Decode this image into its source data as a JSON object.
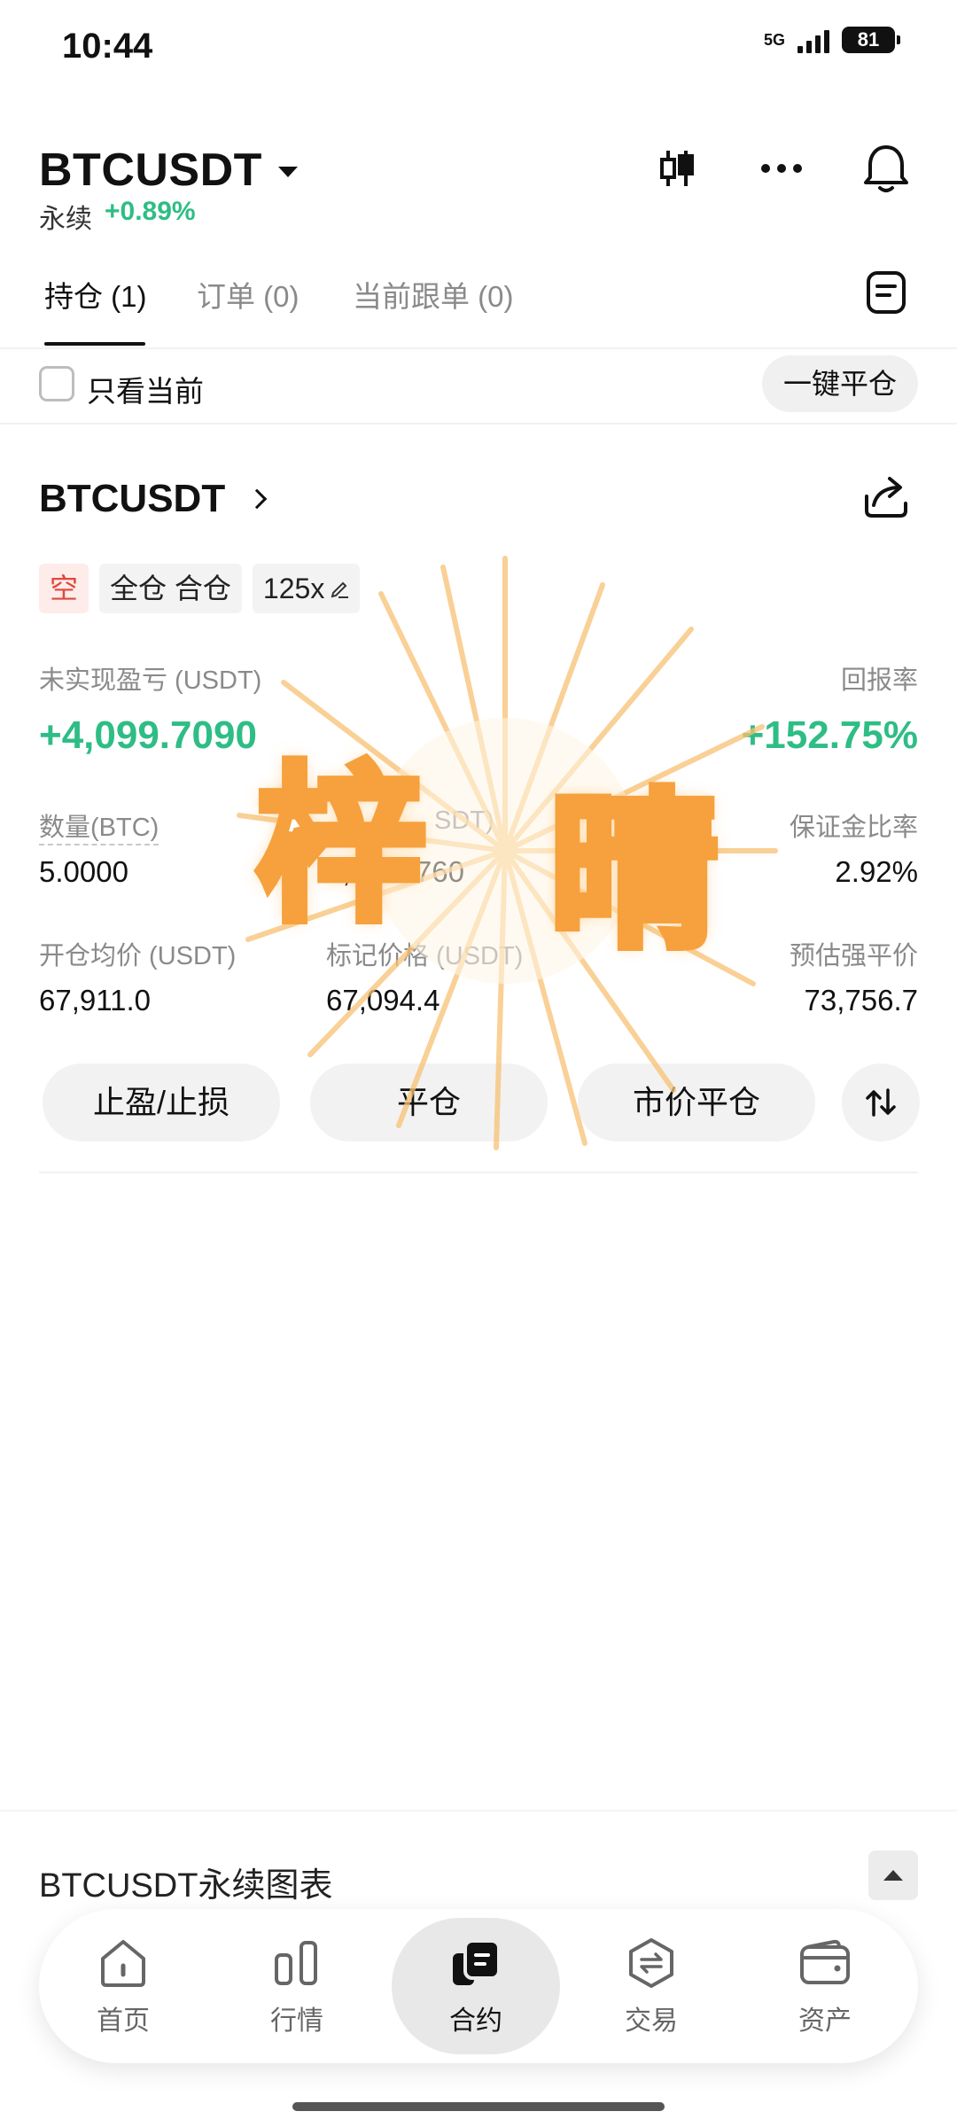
{
  "status_bar": {
    "time": "10:44",
    "network": "5G",
    "battery": "81"
  },
  "header": {
    "symbol": "BTCUSDT",
    "type": "永续",
    "change": "+0.89%"
  },
  "tabs": [
    {
      "label": "持仓 (1)"
    },
    {
      "label": "订单 (0)"
    },
    {
      "label": "当前跟单 (0)"
    }
  ],
  "filter": {
    "only_current_label": "只看当前",
    "close_all_label": "一键平仓"
  },
  "position": {
    "symbol": "BTCUSDT",
    "tags": {
      "side": "空",
      "margin_mode": "全仓 合仓",
      "leverage": "125x"
    },
    "pnl_label": "未实现盈亏 (USDT)",
    "pnl_value": "+4,099.7090",
    "roe_label": "回报率",
    "roe_value": "+152.75%",
    "qty_label": "数量(BTC)",
    "qty_value": "5.0000",
    "margin_label": "SDT)",
    "margin_value": "2,8 3.7760",
    "margin_ratio_label": "保证金比率",
    "margin_ratio_value": "2.92%",
    "entry_label": "开仓均价 (USDT)",
    "entry_value": "67,911.0",
    "mark_label": "标记价格 (USDT)",
    "mark_value": "67,094.4",
    "liq_label": "预估强平价",
    "liq_value": "73,756.7",
    "actions": {
      "tpsl": "止盈/止损",
      "close": "平仓",
      "market_close": "市价平仓"
    }
  },
  "sticker": {
    "char1": "梓",
    "char2": "晴",
    "color": "#f6a13d"
  },
  "chart_section": {
    "title": "BTCUSDT永续图表"
  },
  "bottom_nav": [
    {
      "label": "首页",
      "icon": "home-icon"
    },
    {
      "label": "行情",
      "icon": "market-icon"
    },
    {
      "label": "合约",
      "icon": "futures-icon",
      "active": true
    },
    {
      "label": "交易",
      "icon": "trade-icon"
    },
    {
      "label": "资产",
      "icon": "wallet-icon"
    }
  ],
  "colors": {
    "up": "#2ebd85",
    "down": "#e0483c"
  }
}
